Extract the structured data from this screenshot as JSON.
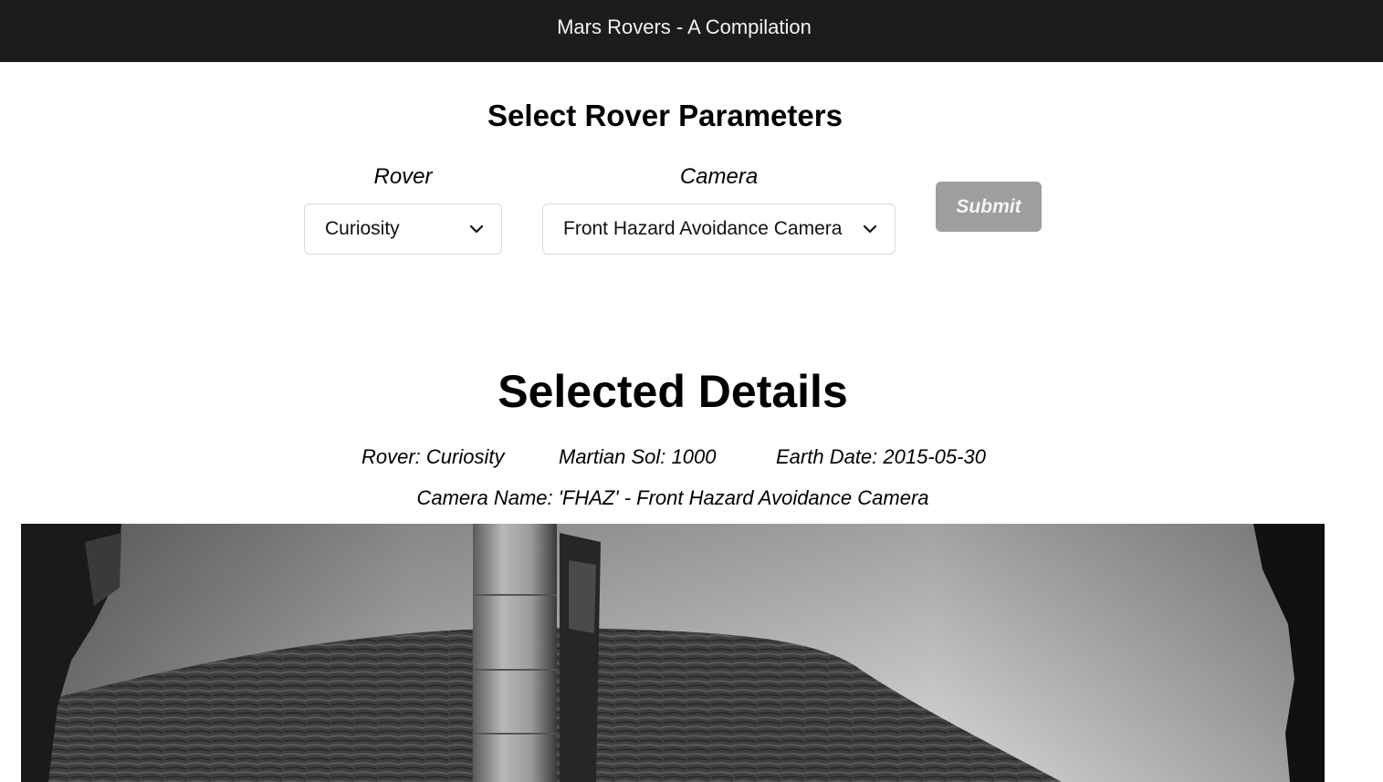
{
  "header": {
    "title": "Mars Rovers - A Compilation"
  },
  "form": {
    "title": "Select Rover Parameters",
    "rover_label": "Rover",
    "rover_value": "Curiosity",
    "camera_label": "Camera",
    "camera_value": "Front Hazard Avoidance Camera",
    "submit_label": "Submit"
  },
  "details": {
    "title": "Selected Details",
    "rover": "Rover: Curiosity",
    "sol": "Martian Sol: 1000",
    "earth_date": "Earth Date: 2015-05-30",
    "camera_name": "Camera Name: 'FHAZ' - Front Hazard Avoidance Camera"
  },
  "icons": {
    "dropdown": "chevron-down-icon"
  },
  "colors": {
    "header_bg": "#1c1c1e",
    "submit_bg": "#9e9e9e"
  }
}
